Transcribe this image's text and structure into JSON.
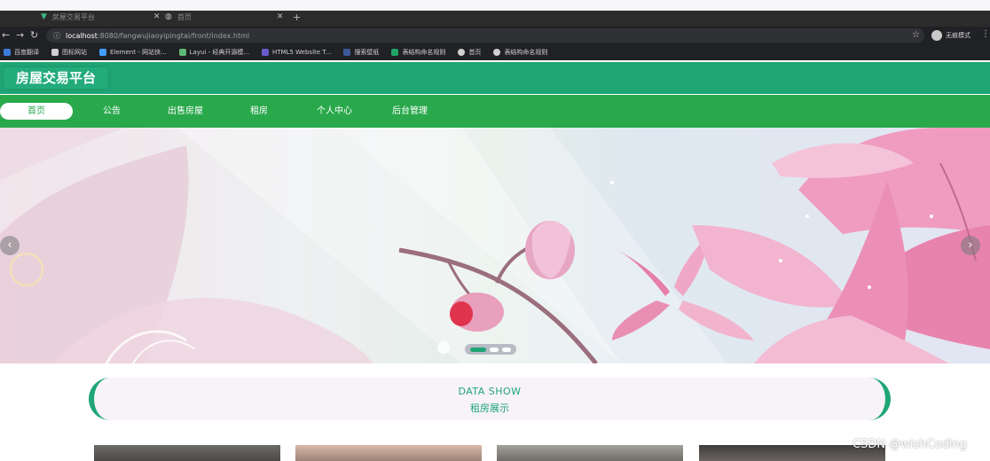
{
  "browser": {
    "tabs": [
      {
        "title": "房屋交易平台",
        "icon": "vue-icon"
      },
      {
        "title": "首页",
        "icon": "globe-icon"
      }
    ],
    "new_tab": "+",
    "url": {
      "host": "localhost",
      "rest": ":8080/fangwujiaoyipingtai/front/index.html"
    },
    "profile_label": "无痕模式",
    "bookmarks": [
      {
        "label": "百度翻译",
        "color": "#3b7ddd"
      },
      {
        "label": "图标网站",
        "color": "#d0d0d0"
      },
      {
        "label": "Element - 网站快...",
        "color": "#409eff"
      },
      {
        "label": "Layui - 经典开源模...",
        "color": "#5fb878"
      },
      {
        "label": "HTML5 Website T...",
        "color": "#6a5acd"
      },
      {
        "label": "搜索壁纸",
        "color": "#3b5998"
      },
      {
        "label": "表结构命名规则",
        "color": "#21a366"
      },
      {
        "label": "首页",
        "color": "#d0d0d0"
      },
      {
        "label": "表结构命名规则",
        "color": "#d0d0d0"
      }
    ]
  },
  "site": {
    "title": "房屋交易平台",
    "nav": [
      {
        "label": "首页",
        "active": true
      },
      {
        "label": "公告",
        "active": false
      },
      {
        "label": "出售房屋",
        "active": false
      },
      {
        "label": "租房",
        "active": false
      },
      {
        "label": "个人中心",
        "active": false
      },
      {
        "label": "后台管理",
        "active": false
      }
    ],
    "colors": {
      "header": "#1fa576",
      "nav": "#2aa94c",
      "accent": "#1fa576"
    }
  },
  "carousel": {
    "prev": "‹",
    "next": "›",
    "slide_count": 3,
    "active_index": 0
  },
  "section": {
    "title_en": "DATA SHOW",
    "title_zh": "租房展示"
  },
  "watermark": "CSDN @wishCoding"
}
